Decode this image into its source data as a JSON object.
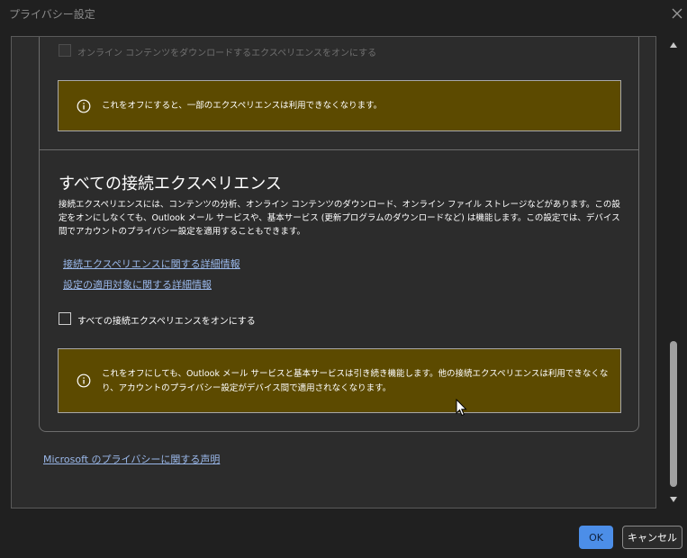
{
  "window": {
    "title": "プライバシー設定",
    "close_icon": "close-icon"
  },
  "top_section": {
    "checkbox_label": "オンライン コンテンツをダウンロードするエクスペリエンスをオンにする",
    "checkbox_checked": false,
    "checkbox_disabled": true,
    "warning_text": "これをオフにすると、一部のエクスペリエンスは利用できなくなります。"
  },
  "connected_section": {
    "heading": "すべての接続エクスペリエンス",
    "description": "接続エクスペリエンスには、コンテンツの分析、オンライン コンテンツのダウンロード、オンライン ファイル ストレージなどがあります。この設定をオンにしなくても、Outlook メール サービスや、基本サービス (更新プログラムのダウンロードなど) は機能します。この設定では、デバイス間でアカウントのプライバシー設定を適用することもできます。",
    "link_details": "接続エクスペリエンスに関する詳細情報",
    "link_scope": "設定の適用対象に関する詳細情報",
    "checkbox_label": "すべての接続エクスペリエンスをオンにする",
    "checkbox_checked": false,
    "warning_text": "これをオフにしても、Outlook メール サービスと基本サービスは引き続き機能します。他の接続エクスペリエンスは利用できなくなり、アカウントのプライバシー設定がデバイス間で適用されなくなります。"
  },
  "privacy_link": "Microsoft のプライバシーに関する声明",
  "buttons": {
    "ok": "OK",
    "cancel": "キャンセル"
  },
  "colors": {
    "background": "#202020",
    "panel": "#2c2c2c",
    "warning_bg": "#5c4a00",
    "accent": "#4c8ee8",
    "link": "#9ab8ea"
  },
  "scroll_position": 0.78
}
